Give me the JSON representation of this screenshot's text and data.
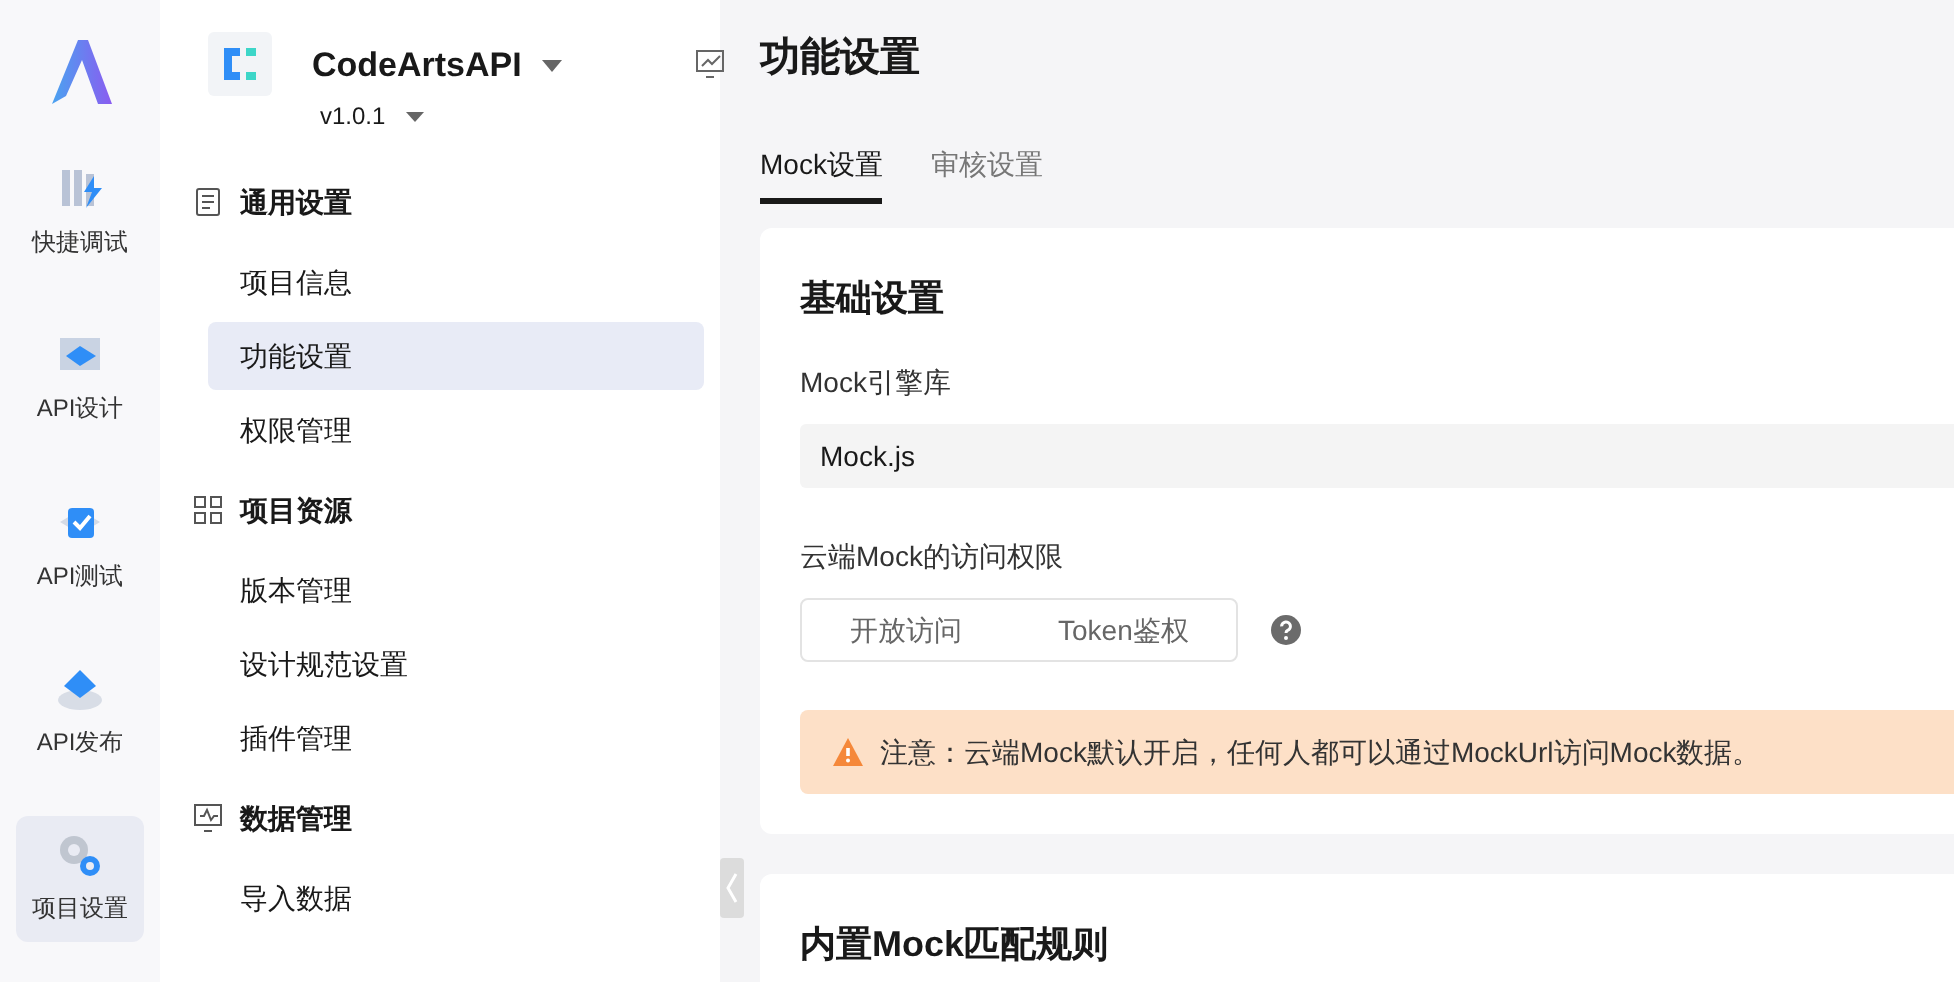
{
  "rail": [
    {
      "kind": "logo"
    },
    {
      "kind": "debug",
      "label": "快捷调试",
      "selected": false
    },
    {
      "kind": "design",
      "label": "API设计",
      "selected": false
    },
    {
      "kind": "test",
      "label": "API测试",
      "selected": false
    },
    {
      "kind": "publish",
      "label": "API发布",
      "selected": false
    },
    {
      "kind": "settings",
      "label": "项目设置",
      "selected": true
    }
  ],
  "project": {
    "name": "CodeArtsAPI",
    "version": "v1.0.1"
  },
  "sidebar": {
    "groups": [
      {
        "kind": "doc",
        "label": "通用设置",
        "children": [
          {
            "label": "项目信息",
            "selected": false
          },
          {
            "label": "功能设置",
            "selected": true
          },
          {
            "label": "权限管理",
            "selected": false
          }
        ]
      },
      {
        "kind": "grid",
        "label": "项目资源",
        "children": [
          {
            "label": "版本管理",
            "selected": false
          },
          {
            "label": "设计规范设置",
            "selected": false
          },
          {
            "label": "插件管理",
            "selected": false
          }
        ]
      },
      {
        "kind": "monitor",
        "label": "数据管理",
        "children": [
          {
            "label": "导入数据",
            "selected": false
          }
        ]
      }
    ]
  },
  "page": {
    "title": "功能设置",
    "tabs": [
      {
        "label": "Mock设置",
        "selected": true
      },
      {
        "label": "审核设置",
        "selected": false
      }
    ],
    "basic": {
      "heading": "基础设置",
      "engine_label": "Mock引擎库",
      "engine_value": "Mock.js",
      "access_label": "云端Mock的访问权限",
      "access_options": [
        {
          "label": "开放访问",
          "selected": false
        },
        {
          "label": "Token鉴权",
          "selected": false
        }
      ],
      "warning": "注意：云端Mock默认开启，任何人都可以通过MockUrl访问Mock数据。"
    },
    "rules": {
      "heading": "内置Mock匹配规则"
    }
  }
}
